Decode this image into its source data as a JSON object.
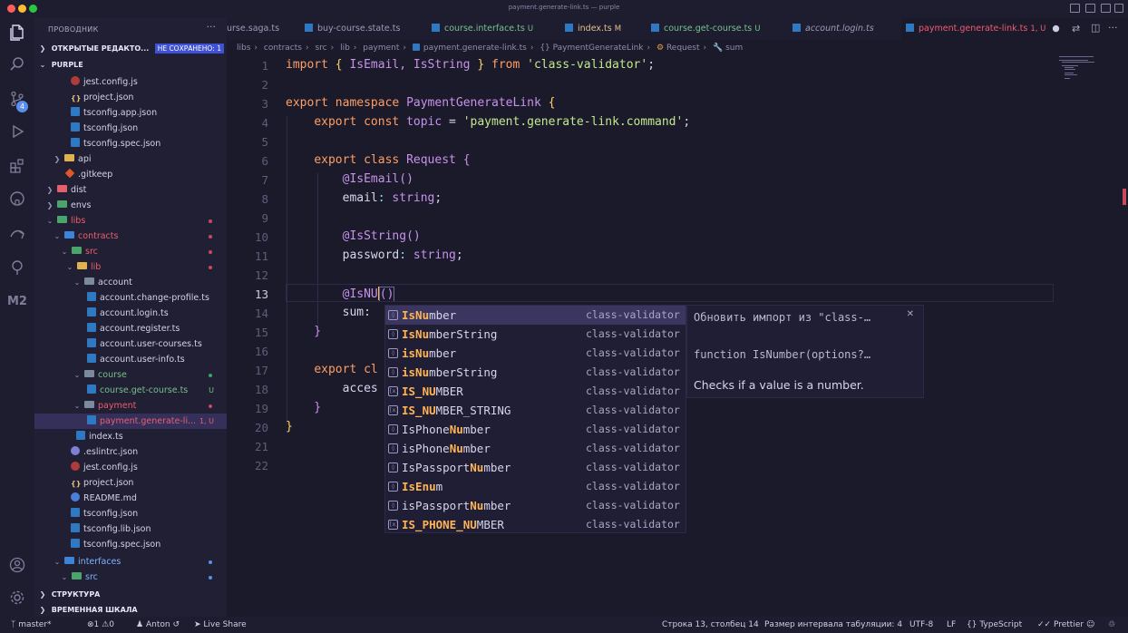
{
  "window": {
    "title": "payment.generate-link.ts — purple",
    "colors": {
      "close": "#ff5f57",
      "minimize": "#febc2e",
      "maximize": "#28c840"
    }
  },
  "activity_bar": {
    "items": [
      "explorer-icon",
      "search-icon",
      "source-control-icon",
      "run-debug-icon",
      "extensions-icon",
      "github-icon",
      "remote-icon",
      "tree-icon",
      "m2-icon"
    ],
    "scm_badge": "4",
    "bottom": [
      "account-icon",
      "settings-gear-icon"
    ]
  },
  "sidebar": {
    "title": "ПРОВОДНИК",
    "open_editors": "ОТКРЫТЫЕ РЕДАКТО...",
    "unsaved_badge": "НЕ СОХРАНЕНО: 1",
    "workspace": "PURPLE",
    "tree": [
      {
        "label": "jest.config.js"
      },
      {
        "label": "project.json"
      },
      {
        "label": "tsconfig.app.json"
      },
      {
        "label": "tsconfig.json"
      },
      {
        "label": "tsconfig.spec.json"
      },
      {
        "label": "api"
      },
      {
        "label": ".gitkeep"
      },
      {
        "label": "dist"
      },
      {
        "label": "envs"
      },
      {
        "label": "libs"
      },
      {
        "label": "contracts"
      },
      {
        "label": "src"
      },
      {
        "label": "lib"
      },
      {
        "label": "account"
      },
      {
        "label": "account.change-profile.ts"
      },
      {
        "label": "account.login.ts"
      },
      {
        "label": "account.register.ts"
      },
      {
        "label": "account.user-courses.ts"
      },
      {
        "label": "account.user-info.ts"
      },
      {
        "label": "course"
      },
      {
        "label": "course.get-course.ts",
        "status": "U"
      },
      {
        "label": "payment"
      },
      {
        "label": "payment.generate-li...",
        "status": "1, U"
      },
      {
        "label": "index.ts"
      },
      {
        "label": ".eslintrc.json"
      },
      {
        "label": "jest.config.js"
      },
      {
        "label": "project.json"
      },
      {
        "label": "README.md"
      },
      {
        "label": "tsconfig.json"
      },
      {
        "label": "tsconfig.lib.json"
      },
      {
        "label": "tsconfig.spec.json"
      },
      {
        "label": "interfaces"
      },
      {
        "label": "src"
      }
    ],
    "structure": "СТРУКТУРА",
    "timeline": "ВРЕМЕННАЯ ШКАЛА"
  },
  "tabs": [
    {
      "label": "urse.saga.ts",
      "mark": ""
    },
    {
      "label": "buy-course.state.ts",
      "mark": ""
    },
    {
      "label": "course.interface.ts",
      "mark": "U"
    },
    {
      "label": "index.ts",
      "mark": "M"
    },
    {
      "label": "course.get-course.ts",
      "mark": "U"
    },
    {
      "label": "account.login.ts",
      "mark": ""
    },
    {
      "label": "payment.generate-link.ts",
      "mark": "1, U"
    }
  ],
  "breadcrumb": [
    "libs",
    "contracts",
    "src",
    "lib",
    "payment",
    "payment.generate-link.ts",
    "{} PaymentGenerateLink",
    "Request",
    "sum"
  ],
  "editor": {
    "line_numbers": [
      "1",
      "2",
      "3",
      "4",
      "5",
      "6",
      "7",
      "8",
      "9",
      "10",
      "11",
      "12",
      "13",
      "14",
      "15",
      "16",
      "17",
      "18",
      "19",
      "20",
      "21",
      "22"
    ],
    "line1": {
      "import": "import",
      "names": "IsEmail, IsString",
      "from": "from",
      "module": "'class-validator'"
    },
    "line3": {
      "export": "export",
      "namespace": "namespace",
      "name": "PaymentGenerateLink"
    },
    "line4": {
      "export": "export",
      "const": "const",
      "name": "topic",
      "value": "'payment.generate-link.command'"
    },
    "line6": {
      "export": "export",
      "class": "class",
      "name": "Request"
    },
    "line7": "@IsEmail()",
    "line8": {
      "prop": "email",
      "type": "string"
    },
    "line10": "@IsString()",
    "line11": {
      "prop": "password",
      "type": "string"
    },
    "line13": "@IsNU",
    "line14": "sum:",
    "line17": {
      "export": "export",
      "rest": "cl"
    },
    "line18": "acces"
  },
  "suggest": {
    "items": [
      {
        "pre": "",
        "match": "IsNu",
        "post": "mber",
        "source": "class-validator",
        "kind": "method"
      },
      {
        "pre": "",
        "match": "IsNu",
        "post": "mberString",
        "source": "class-validator",
        "kind": "method"
      },
      {
        "pre": "",
        "match": "isNu",
        "post": "mber",
        "source": "class-validator",
        "kind": "method"
      },
      {
        "pre": "",
        "match": "isNu",
        "post": "mberString",
        "source": "class-validator",
        "kind": "method"
      },
      {
        "pre": "",
        "match": "IS_NU",
        "post": "MBER",
        "source": "class-validator",
        "kind": "variable"
      },
      {
        "pre": "",
        "match": "IS_NU",
        "post": "MBER_STRING",
        "source": "class-validator",
        "kind": "variable"
      },
      {
        "pre": "IsPhone",
        "match": "Nu",
        "post": "mber",
        "source": "class-validator",
        "kind": "method"
      },
      {
        "pre": "isPhone",
        "match": "Nu",
        "post": "mber",
        "source": "class-validator",
        "kind": "method"
      },
      {
        "pre": "IsPassport",
        "match": "Nu",
        "post": "mber",
        "source": "class-validator",
        "kind": "method"
      },
      {
        "pre": "",
        "match": "IsEnu",
        "post": "m",
        "source": "class-validator",
        "kind": "method"
      },
      {
        "pre": "isPassport",
        "match": "Nu",
        "post": "mber",
        "source": "class-validator",
        "kind": "method"
      },
      {
        "pre": "",
        "match": "IS_PHONE_NU",
        "post": "MBER",
        "source": "class-validator",
        "kind": "variable"
      }
    ],
    "detail": {
      "line1": "Обновить импорт из \"class-…",
      "line2": "function IsNumber(options?…",
      "line3": "Checks if a value is a number."
    }
  },
  "status": {
    "branch": "master*",
    "errors": "1",
    "warnings": "0",
    "user": "Anton",
    "live_share": "Live Share",
    "position": "Строка 13, столбец 14",
    "indent": "Размер интервала табуляции: 4",
    "encoding": "UTF-8",
    "eol": "LF",
    "language": "TypeScript",
    "prettier": "Prettier"
  }
}
